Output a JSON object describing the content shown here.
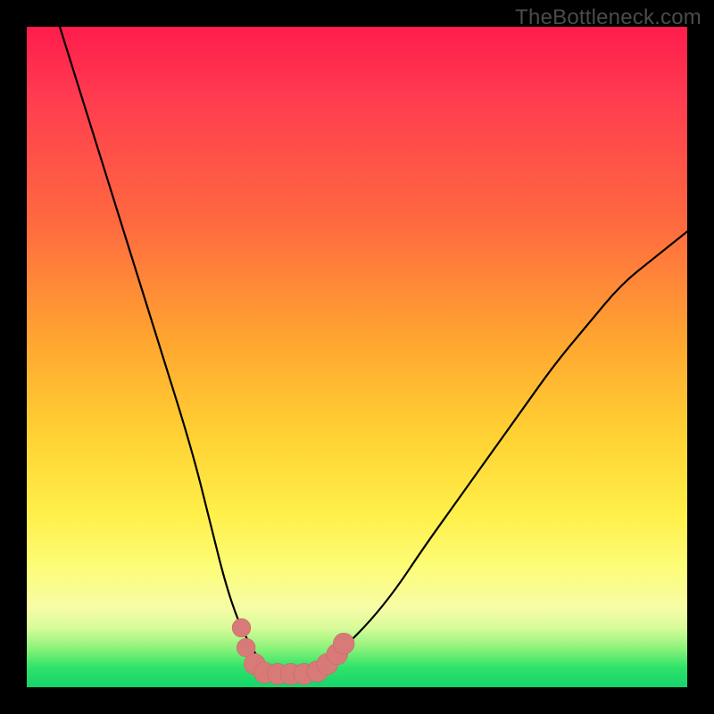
{
  "watermark": {
    "text": "TheBottleneck.com"
  },
  "colors": {
    "curve_stroke": "#000000",
    "marker_fill": "#d77a78",
    "marker_stroke": "#c96a68"
  },
  "chart_data": {
    "type": "line",
    "title": "",
    "xlabel": "",
    "ylabel": "",
    "xlim": [
      0,
      100
    ],
    "ylim": [
      0,
      100
    ],
    "grid": false,
    "series": [
      {
        "name": "bottleneck-curve",
        "x": [
          5,
          10,
          15,
          20,
          25,
          28,
          30,
          32,
          34,
          36,
          38,
          40,
          42,
          45,
          48,
          52,
          56,
          60,
          65,
          70,
          75,
          80,
          85,
          90,
          95,
          100
        ],
        "y": [
          100,
          84,
          68,
          52,
          36,
          24,
          16,
          10,
          6,
          3,
          2,
          2,
          2,
          3,
          6,
          10,
          15,
          21,
          28,
          35,
          42,
          49,
          55,
          61,
          65,
          69
        ]
      }
    ],
    "markers": [
      {
        "x": 32.5,
        "y": 9,
        "r": 1.4
      },
      {
        "x": 33.2,
        "y": 6,
        "r": 1.4
      },
      {
        "x": 34.5,
        "y": 3.5,
        "r": 1.6
      },
      {
        "x": 36.0,
        "y": 2.2,
        "r": 1.6
      },
      {
        "x": 38.0,
        "y": 2.0,
        "r": 1.6
      },
      {
        "x": 40.0,
        "y": 2.0,
        "r": 1.6
      },
      {
        "x": 42.0,
        "y": 2.0,
        "r": 1.6
      },
      {
        "x": 44.0,
        "y": 2.4,
        "r": 1.6
      },
      {
        "x": 45.5,
        "y": 3.5,
        "r": 1.6
      },
      {
        "x": 47.0,
        "y": 5.0,
        "r": 1.6
      },
      {
        "x": 48.0,
        "y": 6.6,
        "r": 1.6
      }
    ]
  }
}
